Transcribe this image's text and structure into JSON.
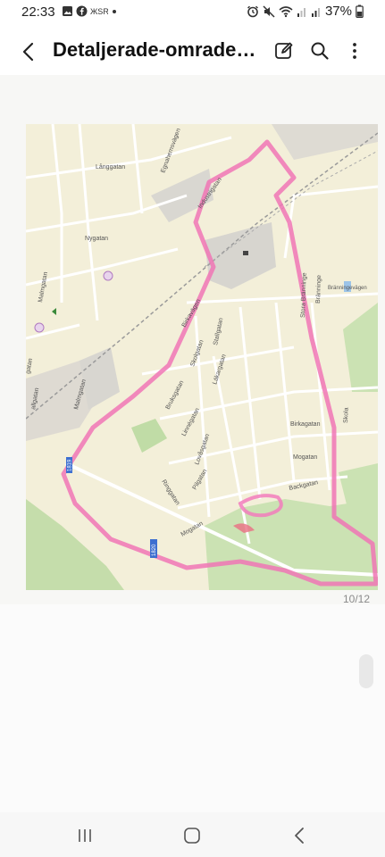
{
  "status_bar": {
    "time": "22:33",
    "battery": "37%",
    "icons": [
      "gallery-icon",
      "facebook-icon",
      "carrier-icon",
      "dot-icon",
      "alarm-icon",
      "mute-icon",
      "wifi-icon",
      "signal-icon",
      "signal-icon",
      "battery-icon"
    ]
  },
  "app_bar": {
    "title": "Detaljerade-omrade…",
    "back_icon": "back-arrow-icon",
    "actions": [
      "edit-icon",
      "search-icon",
      "more-icon"
    ]
  },
  "document": {
    "page_counter": "10/12"
  },
  "map": {
    "labels": {
      "langgatan": "Långgatan",
      "egnahemsvagen": "Egnahemsvägen",
      "nygatan": "Nygatan",
      "industrigatan": "Industrigatan",
      "malmgatan": "Malmgatan",
      "birkavagen": "Birkavägen",
      "branningevagen": "Bränningevägen",
      "stora_branninge": "Stora Bränninge",
      "branninge": "Bränninge",
      "stallgatan": "Stallgatan",
      "skolgatan": "Skolgatan",
      "lakargatan": "Läkargatan",
      "bruksgatan": "Bruksgatan",
      "linnegatan": "Linnégatan",
      "lovasgatan": "Lovåsgatan",
      "birkagatan": "Birkagatan",
      "mogatan": "Mogatan",
      "backgatan": "Backgatan",
      "ringgatan": "Ringgatan",
      "pilgatan": "Pilgatan",
      "skola": "Skola",
      "gatan_w1": "gatan",
      "gatan_w2": "allgatan",
      "road_1": "1819",
      "road_2": "1820"
    }
  },
  "nav_bar": {
    "recents": "recents-icon",
    "home": "home-icon",
    "back": "nav-back-icon"
  }
}
